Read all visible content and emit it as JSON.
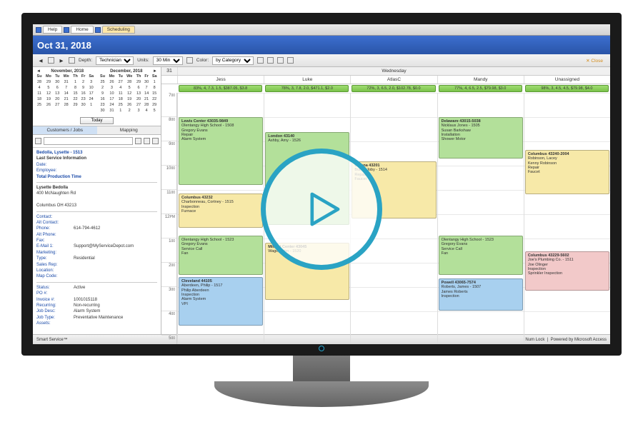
{
  "app_tabs": {
    "help": "Help",
    "home": "Home",
    "scheduling": "Scheduling"
  },
  "date_title": "Oct 31, 2018",
  "toolbar": {
    "depth_label": "Depth:",
    "depth_value": "Technician",
    "units_label": "Units:",
    "units_value": "30 Min",
    "color_label": "Color:",
    "color_value": "by Category",
    "close": "✕ Close"
  },
  "mini_cals": {
    "left": {
      "title": "November, 2018",
      "dow": [
        "Su",
        "Mo",
        "Tu",
        "We",
        "Th",
        "Fr",
        "Sa"
      ],
      "weeks": [
        [
          "28",
          "29",
          "30",
          "31",
          "1",
          "2",
          "3"
        ],
        [
          "4",
          "5",
          "6",
          "7",
          "8",
          "9",
          "10"
        ],
        [
          "11",
          "12",
          "13",
          "14",
          "15",
          "16",
          "17"
        ],
        [
          "18",
          "19",
          "20",
          "21",
          "22",
          "23",
          "24"
        ],
        [
          "25",
          "26",
          "27",
          "28",
          "29",
          "30",
          "1"
        ]
      ]
    },
    "right": {
      "title": "December, 2018",
      "dow": [
        "Su",
        "Mo",
        "Tu",
        "We",
        "Th",
        "Fr",
        "Sa"
      ],
      "weeks": [
        [
          "25",
          "26",
          "27",
          "28",
          "29",
          "30",
          "1"
        ],
        [
          "2",
          "3",
          "4",
          "5",
          "6",
          "7",
          "8"
        ],
        [
          "9",
          "10",
          "11",
          "12",
          "13",
          "14",
          "15"
        ],
        [
          "16",
          "17",
          "18",
          "19",
          "20",
          "21",
          "22"
        ],
        [
          "23",
          "24",
          "25",
          "26",
          "27",
          "28",
          "29"
        ],
        [
          "30",
          "31",
          "1",
          "2",
          "3",
          "4",
          "5"
        ]
      ]
    },
    "today": "Today"
  },
  "side_tabs": {
    "customers": "Customers / Jobs",
    "mapping": "Mapping"
  },
  "customer": {
    "title": "Bedolla, Lysette - 1513",
    "lsi": "Last Service Information",
    "date_lbl": "Date:",
    "emp_lbl": "Employee:",
    "tpt": "Total Production Time",
    "name": "Lysette Bedolla",
    "addr": "400 McNaughten Rd",
    "csz": "Columbus OH 43213",
    "contact_lbl": "Contact:",
    "altcontact_lbl": "Alt Contact:",
    "phone_lbl": "Phone:",
    "phone": "614-794-4612",
    "altphone_lbl": "Alt Phone:",
    "fax_lbl": "Fax:",
    "email_lbl": "E-Mail 1:",
    "email": "Support@MyServiceDepot.com",
    "marketing_lbl": "Marketing:",
    "type_lbl": "Type:",
    "type": "Residential",
    "salesrep_lbl": "Sales Rep:",
    "location_lbl": "Location:",
    "mapcode_lbl": "Map Code:",
    "status_lbl": "Status:",
    "status": "Active",
    "po_lbl": "PO #:",
    "invoice_lbl": "Invoice #:",
    "invoice": "1001015118",
    "recurring_lbl": "Recurring:",
    "recurring": "Non-recurring",
    "jobdesc_lbl": "Job Desc:",
    "jobdesc": "Alarm System",
    "jobtype_lbl": "Job Type:",
    "jobtype": "Preventative Maintenance",
    "assets_lbl": "Assets:"
  },
  "dayheader": {
    "day": "31",
    "wday": "Wednesday"
  },
  "resources": [
    "Jess",
    "Luke",
    "AtlasC",
    "Mandy",
    "Unassigned"
  ],
  "util": [
    "83%, 4, 7.3, 1.5, $387.05, $3.8",
    "78%, 3, 7.8, 2.0, $471.1, $2.0",
    "72%, 3, 6.5, 2.0, $102.78, $0.0",
    "77%, 4, 6.5, 2.5, $79.98, $3.0",
    "98%, 3, 4.5, 4.5, $79.98, $4.0"
  ],
  "hours": [
    "7",
    "8",
    "9",
    "10",
    "11",
    "12",
    "1",
    "2",
    "3",
    "4",
    "5"
  ],
  "ampm": [
    "00",
    "00",
    "00",
    "00",
    "00",
    "PM",
    "00",
    "00",
    "00",
    "00",
    "00"
  ],
  "appts": {
    "a1": {
      "t": "Lewis Center 43035-9849",
      "l": "Olentangy High School - 1508\nGregory Evans\nRepair\nAlarm System"
    },
    "a2": {
      "t": "Columbus 43232",
      "l": "Charbonneau, Cortney - 1515\nInspection\nFurnace"
    },
    "a3": {
      "t": "",
      "l": "Olentangy High School - 1523\nGregory Evans\nService Call\nFan"
    },
    "a4": {
      "t": "Cleveland 44105",
      "l": "Aberdeen, Philip - 1517\nPhilip Aberdeen\nInspection\nAlarm System\nVPI"
    },
    "a5": {
      "t": "London 43140",
      "l": "Ashby, Amy - 1526"
    },
    "a6": {
      "t": "Milford Center 43045",
      "l": "Wage, John - 1520"
    },
    "a7": {
      "t": "Galena 43201",
      "l": "Buller, Joby - 1514\nRepair\nFaucet"
    },
    "a8": {
      "t": "Delaware 43015-5038",
      "l": "Nicklaus Jones - 1505\nSusan Barkshaw\nInstallation\nShower Motor"
    },
    "a9": {
      "t": "",
      "l": "Olentangy High School - 1523\nGregory Evans\nService Call\nFan"
    },
    "a10": {
      "t": "Powell 43065-7574",
      "l": "Roberts, James - 1507\nJames Roberts\nInspection"
    },
    "a11": {
      "t": "Columbus 43240-2004",
      "l": "Robinson, Lacey\nKenny Robinson\nRepair\nFaucet"
    },
    "a12": {
      "t": "Columbus 43229-5602",
      "l": "Joe's Plumbing Co. - 1511\nJoe Olinger\nInspection\nSprinkler Inspection"
    }
  },
  "statusbar": {
    "left": "Smart Service™",
    "lock": "Num Lock",
    "powered": "Powered by Microsoft Access"
  }
}
